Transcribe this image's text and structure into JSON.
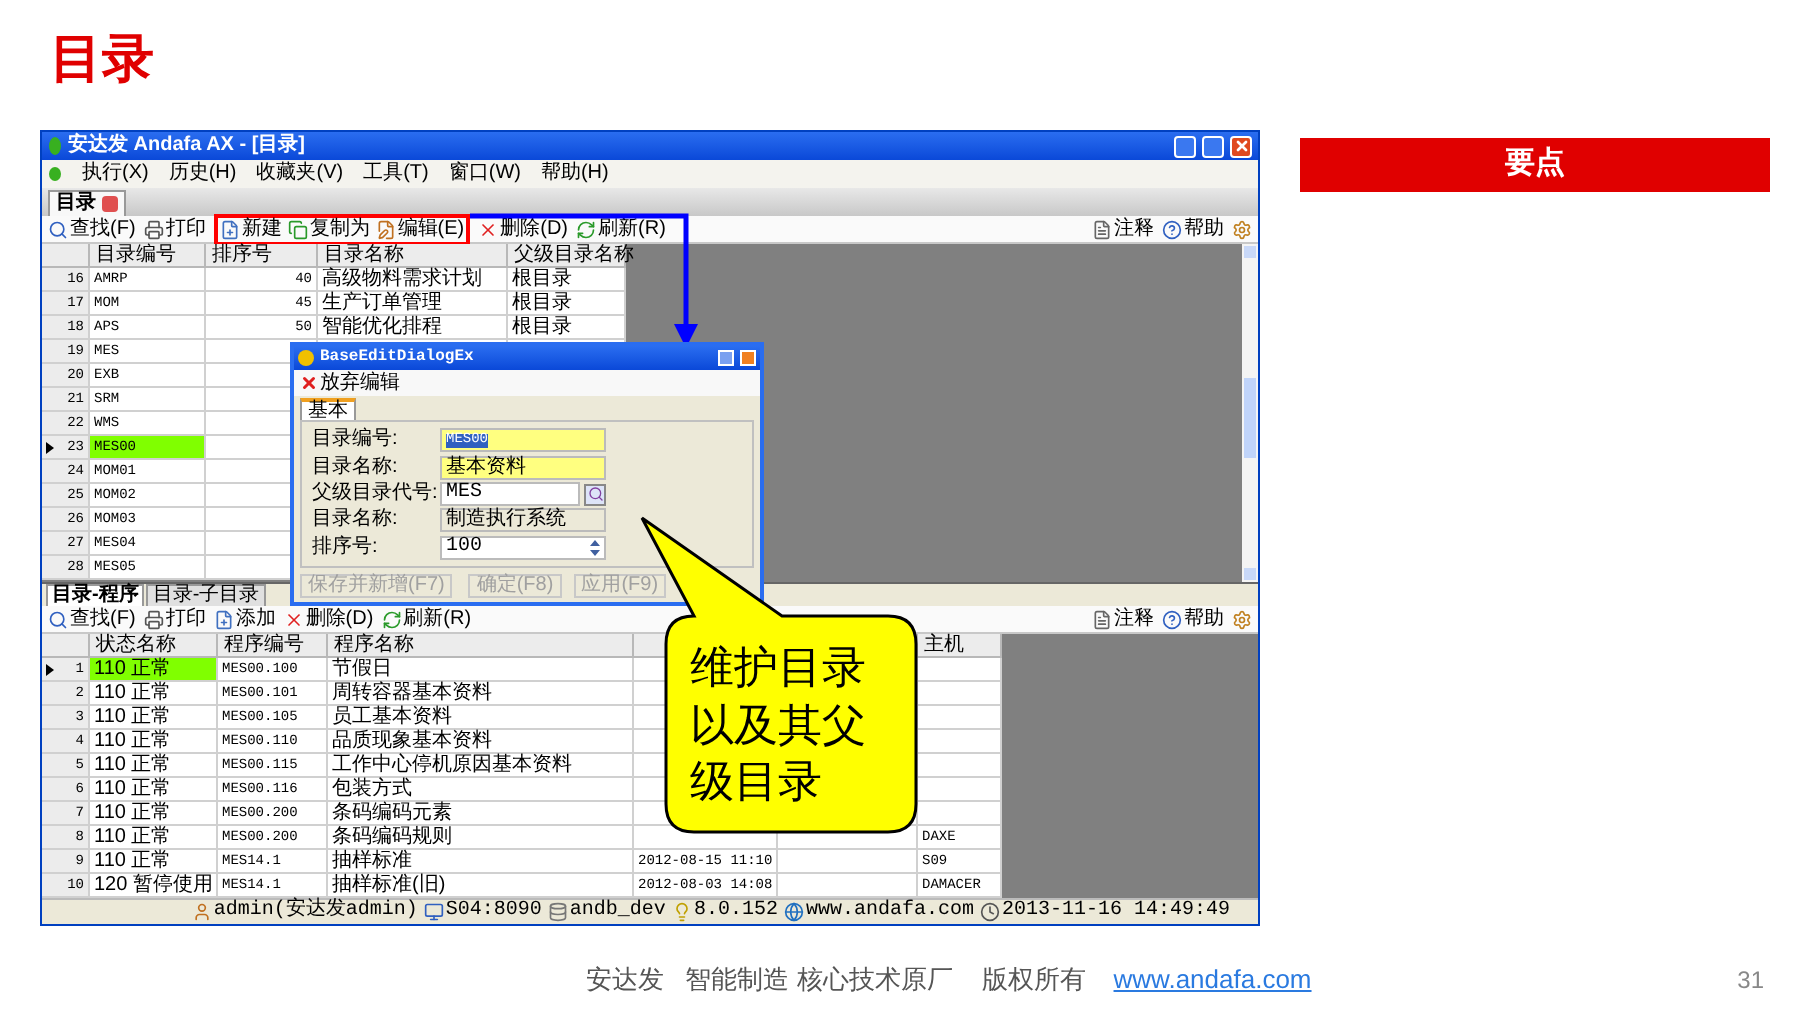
{
  "slide": {
    "title": "目录",
    "key_points": "要点",
    "page_number": "31"
  },
  "footer": {
    "text": "安达发   智能制造 核心技术原厂    版权所有",
    "link": "www.andafa.com"
  },
  "window": {
    "title": "安达发 Andafa AX - [目录]"
  },
  "menu": [
    "执行(X)",
    "历史(H)",
    "收藏夹(V)",
    "工具(T)",
    "窗口(W)",
    "帮助(H)"
  ],
  "doc_tab": {
    "label": "目录"
  },
  "toolbar": [
    {
      "kind": "find",
      "label": "查找(F)",
      "highlighted": false
    },
    {
      "kind": "print",
      "label": "打印",
      "highlighted": false
    },
    {
      "kind": "new",
      "label": "新建",
      "highlighted": true
    },
    {
      "kind": "copy",
      "label": "复制为",
      "highlighted": true
    },
    {
      "kind": "edit",
      "label": "编辑(E)",
      "highlighted": true
    },
    {
      "kind": "delete",
      "label": "删除(D)",
      "highlighted": false
    },
    {
      "kind": "refresh",
      "label": "刷新(R)",
      "highlighted": false
    }
  ],
  "toolbar_right": [
    {
      "kind": "note",
      "label": "注释"
    },
    {
      "kind": "help",
      "label": "帮助"
    }
  ],
  "top_grid": {
    "columns": [
      "目录编号",
      "排序号",
      "目录名称",
      "父级目录名称"
    ],
    "rows": [
      {
        "num": "16",
        "code": "AMRP",
        "sort": "40",
        "name": "高级物料需求计划",
        "parent": "根目录",
        "selected": false
      },
      {
        "num": "17",
        "code": "MOM",
        "sort": "45",
        "name": "生产订单管理",
        "parent": "根目录",
        "selected": false
      },
      {
        "num": "18",
        "code": "APS",
        "sort": "50",
        "name": "智能优化排程",
        "parent": "根目录",
        "selected": false
      },
      {
        "num": "19",
        "code": "MES",
        "selected": false
      },
      {
        "num": "20",
        "code": "EXB",
        "selected": false
      },
      {
        "num": "21",
        "code": "SRM",
        "selected": false
      },
      {
        "num": "22",
        "code": "WMS",
        "selected": false
      },
      {
        "num": "23",
        "code": "MES00",
        "selected": true
      },
      {
        "num": "24",
        "code": "MOM01",
        "selected": false
      },
      {
        "num": "25",
        "code": "MOM02",
        "selected": false
      },
      {
        "num": "26",
        "code": "MOM03",
        "selected": false
      },
      {
        "num": "27",
        "code": "MES04",
        "selected": false
      },
      {
        "num": "28",
        "code": "MES05",
        "selected": false
      }
    ]
  },
  "bottom_tabs": [
    {
      "label": "目录-程序",
      "selected": true
    },
    {
      "label": "目录-子目录",
      "selected": false
    }
  ],
  "bottom_toolbar": [
    {
      "kind": "find",
      "label": "查找(F)"
    },
    {
      "kind": "print",
      "label": "打印"
    },
    {
      "kind": "new",
      "label": "添加"
    },
    {
      "kind": "delete",
      "label": "删除(D)"
    },
    {
      "kind": "refresh",
      "label": "刷新(R)"
    }
  ],
  "bottom_toolbar_right": [
    {
      "kind": "note",
      "label": "注释"
    },
    {
      "kind": "help",
      "label": "帮助"
    }
  ],
  "bottom_grid": {
    "columns": [
      "状态名称",
      "程序编号",
      "程序名称",
      "",
      "",
      "主机"
    ],
    "rows": [
      {
        "num": "1",
        "status": "110 正常",
        "code": "MES00.100",
        "name": "节假日",
        "selected": true
      },
      {
        "num": "2",
        "status": "110 正常",
        "code": "MES00.101",
        "name": "周转容器基本资料",
        "selected": false
      },
      {
        "num": "3",
        "status": "110 正常",
        "code": "MES00.105",
        "name": "员工基本资料",
        "selected": false
      },
      {
        "num": "4",
        "status": "110 正常",
        "code": "MES00.110",
        "name": "品质现象基本资料",
        "selected": false
      },
      {
        "num": "5",
        "status": "110 正常",
        "code": "MES00.115",
        "name": "工作中心停机原因基本资料",
        "selected": false
      },
      {
        "num": "6",
        "status": "110 正常",
        "code": "MES00.116",
        "name": "包装方式",
        "selected": false
      },
      {
        "num": "7",
        "status": "110 正常",
        "code": "MES00.200",
        "name": "条码编码元素",
        "selected": false
      },
      {
        "num": "8",
        "status": "110 正常",
        "code": "MES00.200",
        "name": "条码编码规则",
        "host": "DAXE",
        "selected": false
      },
      {
        "num": "9",
        "status": "110 正常",
        "code": "MES14.1",
        "name": "抽样标准",
        "date": "2012-08-15 11:10",
        "host": "S09",
        "selected": false
      },
      {
        "num": "10",
        "status": "120 暂停使用",
        "code": "MES14.1",
        "name": "抽样标准(旧)",
        "date": "2012-08-03 14:08",
        "host": "DAMACER",
        "selected": false
      }
    ]
  },
  "status_bar": [
    {
      "kind": "user",
      "text": "admin(安达发admin)"
    },
    {
      "kind": "server",
      "text": "S04:8090"
    },
    {
      "kind": "db",
      "text": "andb_dev"
    },
    {
      "kind": "version",
      "text": "8.0.152"
    },
    {
      "kind": "web",
      "text": "www.andafa.com"
    },
    {
      "kind": "clock",
      "text": "2013-11-16 14:49:49"
    }
  ],
  "dialog": {
    "title": "BaseEditDialogEx",
    "discard": "放弃编辑",
    "tab": "基本",
    "fields": [
      {
        "kind": "text",
        "label": "目录编号:",
        "value": "MES00",
        "required": true
      },
      {
        "kind": "text",
        "label": "目录名称:",
        "value": "基本资料",
        "required": true
      },
      {
        "kind": "lookup",
        "label": "父级目录代号:",
        "value": "MES",
        "required": false
      },
      {
        "kind": "readonly",
        "label": "目录名称:",
        "value": "制造执行系统",
        "required": false
      },
      {
        "kind": "spin",
        "label": "排序号:",
        "value": "100",
        "required": false
      }
    ],
    "buttons": [
      {
        "label": "保存并新增(F7)",
        "disabled": true
      },
      {
        "label": "确定(F8)",
        "disabled": true
      },
      {
        "label": "应用(F9)",
        "disabled": true
      }
    ]
  },
  "callout": {
    "text": "维护目录以及其父级目录"
  }
}
